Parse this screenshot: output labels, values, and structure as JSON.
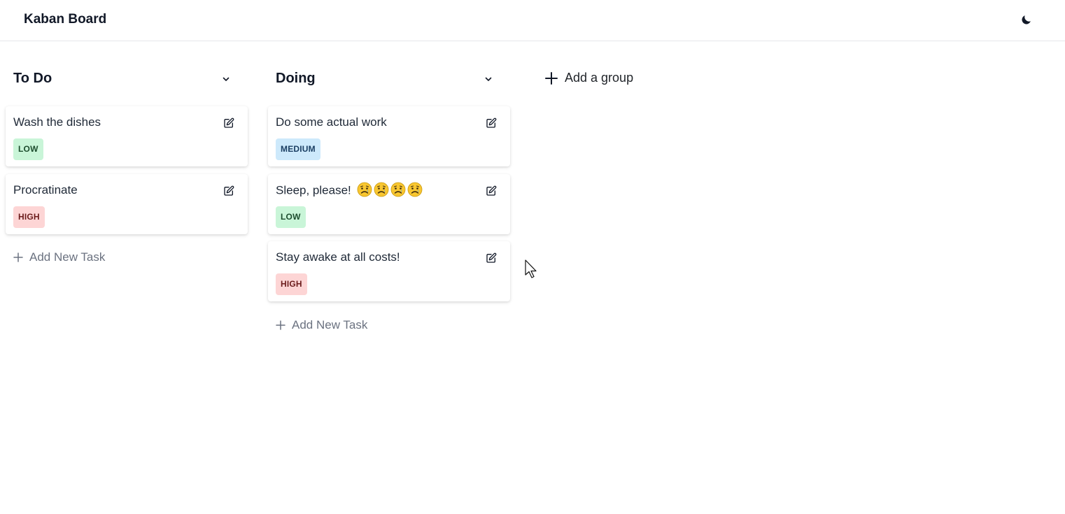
{
  "header": {
    "title": "Kaban Board",
    "theme_toggle_icon": "moon-icon"
  },
  "columns": [
    {
      "title": "To Do",
      "collapse_icon": "chevron-down-icon",
      "tasks": [
        {
          "title": "Wash the dishes",
          "priority": "LOW"
        },
        {
          "title": "Procratinate",
          "priority": "HIGH"
        }
      ],
      "add_task_label": "Add New Task"
    },
    {
      "title": "Doing",
      "collapse_icon": "chevron-down-icon",
      "tasks": [
        {
          "title": "Do some actual work",
          "priority": "MEDIUM"
        },
        {
          "title": "Sleep, please!",
          "emoji": [
            "😥",
            "😥",
            "😥",
            "😥"
          ],
          "priority": "LOW"
        },
        {
          "title": "Stay awake at all costs!",
          "priority": "HIGH"
        }
      ],
      "add_task_label": "Add New Task"
    }
  ],
  "add_group_label": "Add a group",
  "colors": {
    "low_bg": "#c9f5d8",
    "medium_bg": "#cde9fb",
    "high_bg": "#fdd5d5"
  }
}
